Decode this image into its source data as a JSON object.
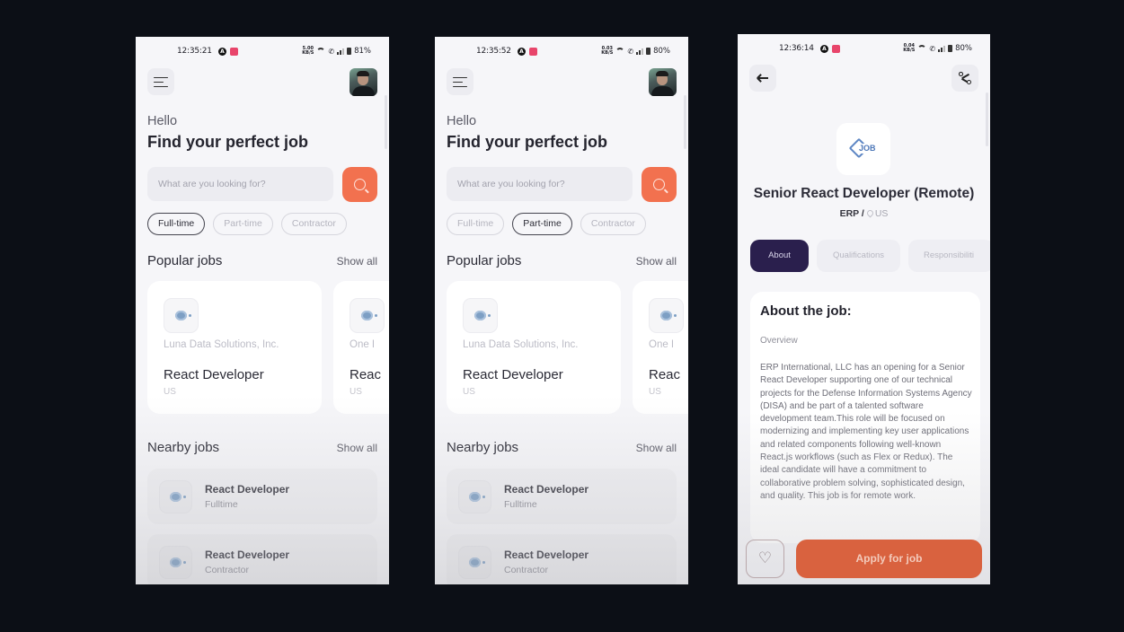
{
  "screens": [
    {
      "status": {
        "time": "12:35:21",
        "net_speed": "5.00",
        "net_unit": "KB/S",
        "battery": "81%"
      },
      "greeting": "Hello",
      "headline": "Find your perfect job",
      "search": {
        "placeholder": "What are you looking for?",
        "button_icon": "search-icon"
      },
      "chips": [
        {
          "label": "Full-time",
          "active": true
        },
        {
          "label": "Part-time",
          "active": false
        },
        {
          "label": "Contractor",
          "active": false
        }
      ],
      "popular": {
        "title": "Popular jobs",
        "show_all": "Show all",
        "cards": [
          {
            "company": "Luna Data Solutions, Inc.",
            "role": "React Developer",
            "location": "US"
          },
          {
            "company": "One I",
            "role": "Reac",
            "location": "US"
          }
        ]
      },
      "nearby": {
        "title": "Nearby jobs",
        "show_all": "Show all",
        "items": [
          {
            "role": "React Developer",
            "type": "Fulltime"
          },
          {
            "role": "React Developer",
            "type": "Contractor"
          }
        ]
      }
    },
    {
      "status": {
        "time": "12:35:52",
        "net_speed": "0.03",
        "net_unit": "KB/S",
        "battery": "80%"
      },
      "greeting": "Hello",
      "headline": "Find your perfect job",
      "search": {
        "placeholder": "What are you looking for?",
        "button_icon": "search-icon"
      },
      "chips": [
        {
          "label": "Full-time",
          "active": false
        },
        {
          "label": "Part-time",
          "active": true
        },
        {
          "label": "Contractor",
          "active": false
        }
      ],
      "popular": {
        "title": "Popular jobs",
        "show_all": "Show all",
        "cards": [
          {
            "company": "Luna Data Solutions, Inc.",
            "role": "React Developer",
            "location": "US"
          },
          {
            "company": "One I",
            "role": "Reac",
            "location": "US"
          }
        ]
      },
      "nearby": {
        "title": "Nearby jobs",
        "show_all": "Show all",
        "items": [
          {
            "role": "React Developer",
            "type": "Fulltime"
          },
          {
            "role": "React Developer",
            "type": "Contractor"
          }
        ]
      }
    },
    {
      "status": {
        "time": "12:36:14",
        "net_speed": "0.04",
        "net_unit": "KB/S",
        "battery": "80%"
      },
      "logo_text": "JOB",
      "job_title": "Senior React Developer (Remote)",
      "company": "ERP /",
      "location": "US",
      "tabs": [
        {
          "label": "About",
          "active": true
        },
        {
          "label": "Qualifications",
          "active": false
        },
        {
          "label": "Responsibiliti",
          "active": false
        }
      ],
      "about": {
        "title": "About the job:",
        "subtitle": "Overview",
        "body": "ERP International, LLC has an opening for a Senior React Developer supporting one of our technical projects for the Defense Information Systems Agency (DISA) and be part of a talented software development team.This role will be focused on modernizing and implementing key user applications and related components following well-known React.js workflows (such as Flex or Redux). The ideal candidate will have a commitment to collaborative problem solving, sophisticated design, and quality. This job is for remote work."
      },
      "apply_label": "Apply for job",
      "favorite_icon": "heart-icon"
    }
  ],
  "colors": {
    "accent": "#f2714f",
    "apply": "#d9623f",
    "tab_active": "#2a1f4d",
    "background": "#0c0f16"
  }
}
